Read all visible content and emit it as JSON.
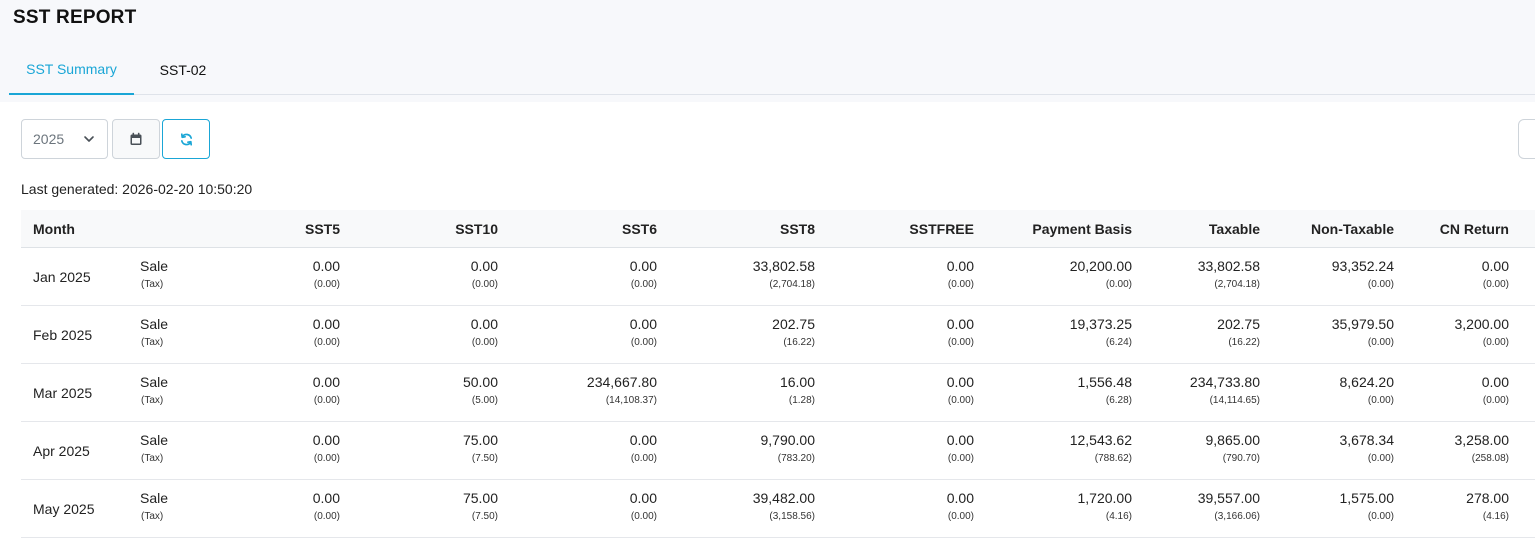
{
  "page": {
    "title": "SST REPORT"
  },
  "tabs": [
    {
      "label": "SST Summary",
      "active": true
    },
    {
      "label": "SST-02",
      "active": false
    }
  ],
  "toolbar": {
    "year": "2025",
    "calendar_icon": "calendar-icon",
    "refresh_icon": "refresh-icon",
    "accent_color": "#1aa6d6"
  },
  "last_generated": "Last generated: 2026-02-20 10:50:20",
  "table": {
    "headers": {
      "month": "Month",
      "sst5": "SST5",
      "sst10": "SST10",
      "sst6": "SST6",
      "sst8": "SST8",
      "sstfree": "SSTFREE",
      "payment": "Payment Basis",
      "taxable": "Taxable",
      "nontax": "Non-Taxable",
      "cn": "CN Return"
    },
    "rows": [
      {
        "month": "Jan 2025",
        "type": "Sale",
        "type_sub": "(Tax)",
        "sst5": "0.00",
        "sst5_tax": "(0.00)",
        "sst10": "0.00",
        "sst10_tax": "(0.00)",
        "sst6": "0.00",
        "sst6_tax": "(0.00)",
        "sst8": "33,802.58",
        "sst8_tax": "(2,704.18)",
        "sstfree": "0.00",
        "sstfree_tax": "(0.00)",
        "payment": "20,200.00",
        "payment_tax": "(0.00)",
        "taxable": "33,802.58",
        "taxable_tax": "(2,704.18)",
        "nontax": "93,352.24",
        "nontax_tax": "(0.00)",
        "cn": "0.00",
        "cn_tax": "(0.00)"
      },
      {
        "month": "Feb 2025",
        "type": "Sale",
        "type_sub": "(Tax)",
        "sst5": "0.00",
        "sst5_tax": "(0.00)",
        "sst10": "0.00",
        "sst10_tax": "(0.00)",
        "sst6": "0.00",
        "sst6_tax": "(0.00)",
        "sst8": "202.75",
        "sst8_tax": "(16.22)",
        "sstfree": "0.00",
        "sstfree_tax": "(0.00)",
        "payment": "19,373.25",
        "payment_tax": "(6.24)",
        "taxable": "202.75",
        "taxable_tax": "(16.22)",
        "nontax": "35,979.50",
        "nontax_tax": "(0.00)",
        "cn": "3,200.00",
        "cn_tax": "(0.00)"
      },
      {
        "month": "Mar 2025",
        "type": "Sale",
        "type_sub": "(Tax)",
        "sst5": "0.00",
        "sst5_tax": "(0.00)",
        "sst10": "50.00",
        "sst10_tax": "(5.00)",
        "sst6": "234,667.80",
        "sst6_tax": "(14,108.37)",
        "sst8": "16.00",
        "sst8_tax": "(1.28)",
        "sstfree": "0.00",
        "sstfree_tax": "(0.00)",
        "payment": "1,556.48",
        "payment_tax": "(6.28)",
        "taxable": "234,733.80",
        "taxable_tax": "(14,114.65)",
        "nontax": "8,624.20",
        "nontax_tax": "(0.00)",
        "cn": "0.00",
        "cn_tax": "(0.00)"
      },
      {
        "month": "Apr 2025",
        "type": "Sale",
        "type_sub": "(Tax)",
        "sst5": "0.00",
        "sst5_tax": "(0.00)",
        "sst10": "75.00",
        "sst10_tax": "(7.50)",
        "sst6": "0.00",
        "sst6_tax": "(0.00)",
        "sst8": "9,790.00",
        "sst8_tax": "(783.20)",
        "sstfree": "0.00",
        "sstfree_tax": "(0.00)",
        "payment": "12,543.62",
        "payment_tax": "(788.62)",
        "taxable": "9,865.00",
        "taxable_tax": "(790.70)",
        "nontax": "3,678.34",
        "nontax_tax": "(0.00)",
        "cn": "3,258.00",
        "cn_tax": "(258.08)"
      },
      {
        "month": "May 2025",
        "type": "Sale",
        "type_sub": "(Tax)",
        "sst5": "0.00",
        "sst5_tax": "(0.00)",
        "sst10": "75.00",
        "sst10_tax": "(7.50)",
        "sst6": "0.00",
        "sst6_tax": "(0.00)",
        "sst8": "39,482.00",
        "sst8_tax": "(3,158.56)",
        "sstfree": "0.00",
        "sstfree_tax": "(0.00)",
        "payment": "1,720.00",
        "payment_tax": "(4.16)",
        "taxable": "39,557.00",
        "taxable_tax": "(3,166.06)",
        "nontax": "1,575.00",
        "nontax_tax": "(0.00)",
        "cn": "278.00",
        "cn_tax": "(4.16)"
      }
    ]
  }
}
